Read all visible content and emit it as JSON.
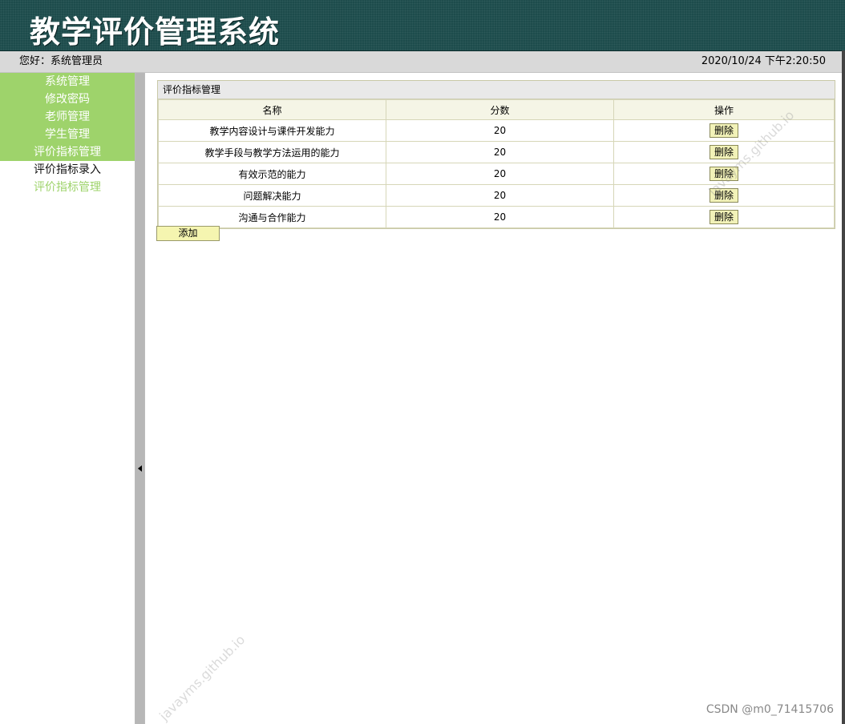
{
  "header": {
    "title": "教学评价管理系统"
  },
  "userbar": {
    "greeting": "您好：系统管理员",
    "datetime": "2020/10/24 下午2:20:50"
  },
  "sidebar": {
    "items": [
      {
        "label": "系统管理"
      },
      {
        "label": "修改密码"
      },
      {
        "label": "老师管理"
      },
      {
        "label": "学生管理"
      },
      {
        "label": "评价指标管理"
      }
    ],
    "subitems": [
      {
        "label": "评价指标录入"
      },
      {
        "label": "评价指标管理"
      }
    ]
  },
  "panel": {
    "title": "评价指标管理",
    "columns": [
      "名称",
      "分数",
      "操作"
    ],
    "rows": [
      {
        "name": "教学内容设计与课件开发能力",
        "score": "20",
        "action": "删除"
      },
      {
        "name": "教学手段与教学方法运用的能力",
        "score": "20",
        "action": "删除"
      },
      {
        "name": "有效示范的能力",
        "score": "20",
        "action": "删除"
      },
      {
        "name": "问题解决能力",
        "score": "20",
        "action": "删除"
      },
      {
        "name": "沟通与合作能力",
        "score": "20",
        "action": "删除"
      }
    ],
    "add_label": "添加"
  },
  "watermark": {
    "text": "javayms.github.io"
  },
  "footer": {
    "credit": "CSDN @m0_71415706"
  }
}
